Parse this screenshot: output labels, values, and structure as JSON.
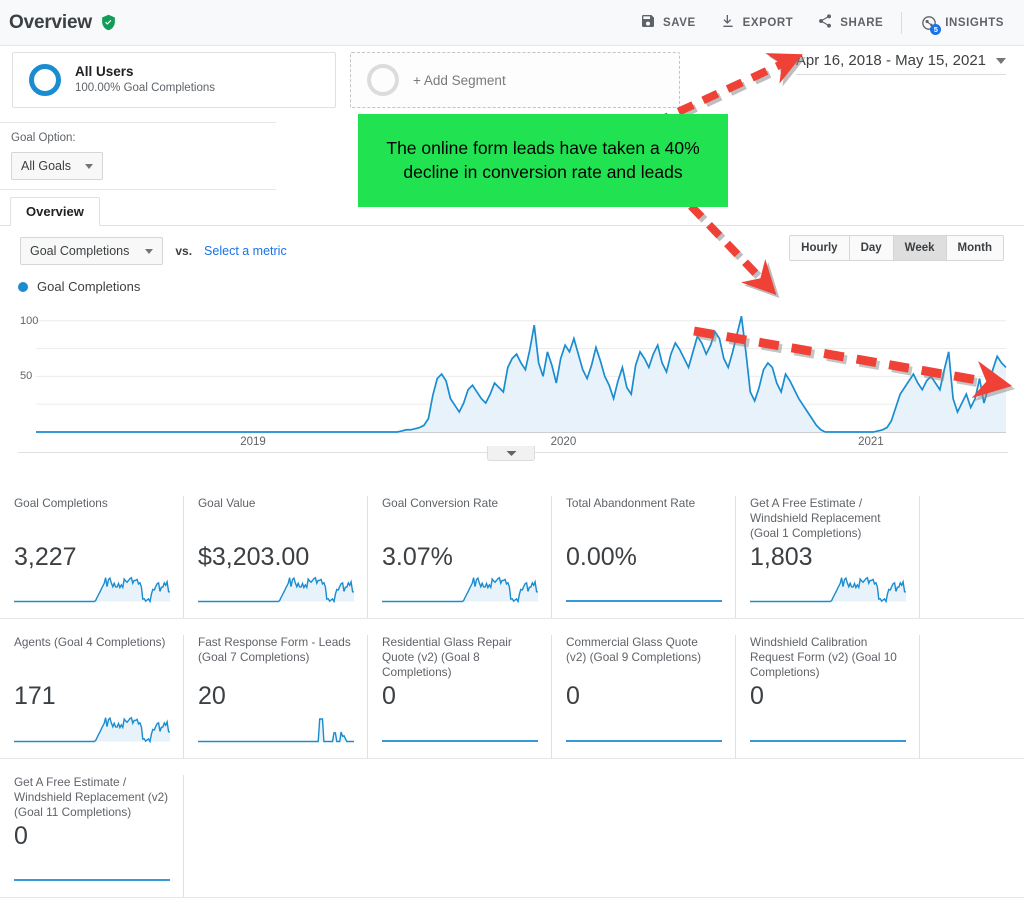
{
  "header": {
    "title": "Overview",
    "verified_icon": "verified-shield-icon",
    "actions": [
      {
        "label": "SAVE",
        "icon": "save-icon"
      },
      {
        "label": "EXPORT",
        "icon": "export-download-icon"
      },
      {
        "label": "SHARE",
        "icon": "share-icon"
      },
      {
        "label": "INSIGHTS",
        "icon": "insights-icon",
        "badge": "5"
      }
    ]
  },
  "segments": {
    "primary": {
      "title": "All Users",
      "subtitle": "100.00% Goal Completions",
      "ring_color": "#1a8cd0"
    },
    "add_segment_label": "+ Add Segment"
  },
  "date_range": {
    "value": "Apr 16, 2018 - May 15, 2021",
    "caret_icon": "chevron-down-icon"
  },
  "goal_option": {
    "label": "Goal Option:",
    "selected": "All Goals"
  },
  "tabs": [
    {
      "label": "Overview",
      "active": true
    }
  ],
  "metric_selector": {
    "primary_metric": "Goal Completions",
    "vs_label": "vs.",
    "secondary_placeholder": "Select a metric"
  },
  "granularity": {
    "options": [
      "Hourly",
      "Day",
      "Week",
      "Month"
    ],
    "selected": "Week"
  },
  "legend": {
    "label": "Goal Completions",
    "color": "#1a8cd0"
  },
  "annotation": {
    "text": "The online form leads have taken a 40% decline in conversion rate and leads",
    "background": "#21e351",
    "arrow_color": "#ef4136"
  },
  "chart_data": {
    "type": "area",
    "title": "Goal Completions",
    "xlabel": "",
    "ylabel": "",
    "ylim": [
      0,
      115
    ],
    "yticks": [
      50,
      100
    ],
    "xticks": [
      "2019",
      "2020",
      "2021"
    ],
    "grid": true,
    "series": [
      {
        "name": "Goal Completions",
        "color": "#1a8cd0",
        "fill": "#e8f2fa",
        "values": [
          0,
          0,
          0,
          0,
          0,
          0,
          0,
          0,
          0,
          0,
          0,
          0,
          0,
          0,
          0,
          0,
          0,
          0,
          0,
          0,
          0,
          0,
          0,
          0,
          0,
          0,
          0,
          0,
          0,
          0,
          0,
          0,
          0,
          0,
          0,
          0,
          0,
          0,
          0,
          0,
          0,
          0,
          0,
          0,
          0,
          0,
          0,
          0,
          0,
          0,
          0,
          0,
          0,
          0,
          0,
          0,
          0,
          0,
          0,
          0,
          0,
          0,
          0,
          0,
          0,
          0,
          0,
          0,
          0,
          0,
          0,
          0,
          0,
          0,
          0,
          0,
          0,
          0,
          0,
          0,
          0,
          0,
          0,
          1,
          2,
          2,
          3,
          4,
          6,
          12,
          33,
          48,
          52,
          46,
          30,
          24,
          18,
          26,
          38,
          42,
          36,
          30,
          26,
          34,
          44,
          40,
          36,
          58,
          66,
          70,
          62,
          56,
          74,
          96,
          62,
          50,
          72,
          60,
          44,
          66,
          78,
          72,
          84,
          70,
          56,
          48,
          60,
          76,
          64,
          50,
          42,
          30,
          46,
          58,
          40,
          34,
          60,
          72,
          66,
          58,
          70,
          78,
          62,
          54,
          70,
          80,
          74,
          66,
          58,
          72,
          86,
          80,
          70,
          78,
          90,
          84,
          66,
          58,
          72,
          88,
          104,
          72,
          36,
          28,
          40,
          56,
          62,
          58,
          44,
          36,
          52,
          46,
          38,
          30,
          24,
          18,
          12,
          6,
          2,
          0,
          0,
          0,
          0,
          0,
          0,
          0,
          0,
          0,
          0,
          0,
          0,
          1,
          2,
          4,
          10,
          22,
          34,
          40,
          46,
          52,
          44,
          38,
          46,
          50,
          44,
          38,
          56,
          72,
          30,
          18,
          26,
          34,
          22,
          30,
          48,
          26,
          40,
          56,
          68,
          62,
          58
        ]
      }
    ],
    "trendline": {
      "label": "decline trend",
      "from": [
        0.62,
        72
      ],
      "to": [
        0.99,
        40
      ],
      "color": "#ef4136"
    }
  },
  "cards": [
    [
      {
        "title": "Goal Completions",
        "value": "3,227",
        "spark": "active"
      },
      {
        "title": "Goal Value",
        "value": "$3,203.00",
        "spark": "active"
      },
      {
        "title": "Goal Conversion Rate",
        "value": "3.07%",
        "spark": "active"
      },
      {
        "title": "Total Abandonment Rate",
        "value": "0.00%",
        "spark": "flat"
      },
      {
        "title": "Get A Free Estimate / Windshield Replacement (Goal 1 Completions)",
        "value": "1,803",
        "spark": "active"
      }
    ],
    [
      {
        "title": "Agents (Goal 4 Completions)",
        "value": "171",
        "spark": "active"
      },
      {
        "title": "Fast Response Form - Leads (Goal 7 Completions)",
        "value": "20",
        "spark": "spiky"
      },
      {
        "title": "Residential Glass Repair Quote (v2) (Goal 8 Completions)",
        "value": "0",
        "spark": "flat"
      },
      {
        "title": "Commercial Glass Quote (v2) (Goal 9 Completions)",
        "value": "0",
        "spark": "flat"
      },
      {
        "title": "Windshield Calibration Request Form (v2) (Goal 10 Completions)",
        "value": "0",
        "spark": "flat"
      }
    ],
    [
      {
        "title": "Get A Free Estimate / Windshield Replacement (v2) (Goal 11 Completions)",
        "value": "0",
        "spark": "flat"
      }
    ]
  ]
}
